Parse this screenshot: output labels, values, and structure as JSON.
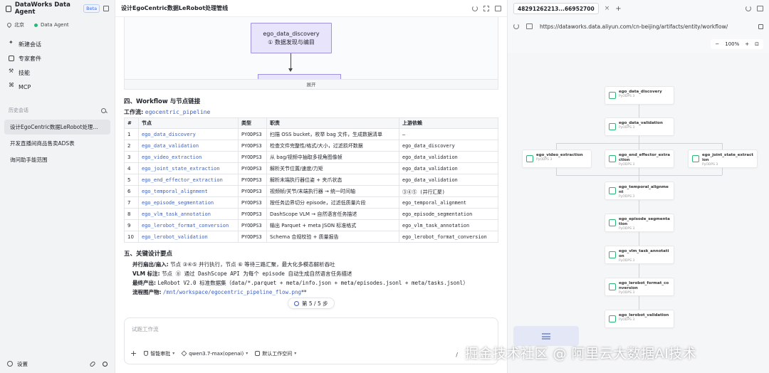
{
  "app": {
    "title": "DataWorks Data Agent",
    "badge": "Beta"
  },
  "sidebar": {
    "region": "北京",
    "agent": "Data Agent",
    "nav": [
      {
        "label": "新建会话",
        "icon": "sparkle-icon"
      },
      {
        "label": "专家套件",
        "icon": "box-icon"
      },
      {
        "label": "技能",
        "icon": "wrench-icon"
      },
      {
        "label": "MCP",
        "icon": "mcp-icon"
      }
    ],
    "history_title": "历史会话",
    "history": [
      "设计EgoCentric数据LeRobot处理...",
      "开发直播间商品售卖ADS表",
      "询问助手能范围"
    ],
    "settings": "设置"
  },
  "main": {
    "title": "设计EgoCentric数据LeRobot处理管线",
    "diagram": {
      "node_name": "ego_data_discovery",
      "node_desc": "① 数据发现与编目",
      "expand": "展开"
    },
    "section4": "四、Workflow 与节点链接",
    "workflow_label": "工作流:",
    "workflow_name": "egocentric_pipeline",
    "table": {
      "headers": [
        "#",
        "节点",
        "类型",
        "职责",
        "上游依赖"
      ],
      "rows": [
        [
          "1",
          "ego_data_discovery",
          "PYODPS3",
          "扫描 OSS bucket，枚举 bag 文件，生成数据清单",
          "—"
        ],
        [
          "2",
          "ego_data_validation",
          "PYODPS3",
          "检查文件完整性/格式/大小，过滤损坏数据",
          "ego_data_discovery"
        ],
        [
          "3",
          "ego_video_extraction",
          "PYODPS3",
          "从 bag/视频中抽取多视角图像帧",
          "ego_data_validation"
        ],
        [
          "4",
          "ego_joint_state_extraction",
          "PYODPS3",
          "解析关节位置/速度/力矩",
          "ego_data_validation"
        ],
        [
          "5",
          "ego_end_effector_extraction",
          "PYODPS3",
          "解析末端执行器位姿 + 夹爪状态",
          "ego_data_validation"
        ],
        [
          "6",
          "ego_temporal_alignment",
          "PYODPS3",
          "视频帧/关节/末端执行器 → 统一时间轴",
          "③④⑤ (并行汇聚)"
        ],
        [
          "7",
          "ego_episode_segmentation",
          "PYODPS3",
          "按任务边界切分 episode，过滤低质量片段",
          "ego_temporal_alignment"
        ],
        [
          "8",
          "ego_vlm_task_annotation",
          "PYODPS3",
          "DashScope VLM → 自然语言任务描述",
          "ego_episode_segmentation"
        ],
        [
          "9",
          "ego_lerobot_format_conversion",
          "PYODPS3",
          "输出 Parquet + meta JSON 标准格式",
          "ego_vlm_task_annotation"
        ],
        [
          "10",
          "ego_lerobot_validation",
          "PYODPS3",
          "Schema 合规校验 + 质量报告",
          "ego_lerobot_format_conversion"
        ]
      ]
    },
    "section5": "五、关键设计要点",
    "points": [
      {
        "label": "并行扇出/扇入:",
        "text": "节点 ③④⑤ 并行执行，节点 ⑥ 等待三路汇聚，最大化多模态解析吞吐"
      },
      {
        "label": "VLM 标注:",
        "text": "节点 ⑧ 通过 DashScope API 为每个 episode 自动生成自然语言任务描述"
      },
      {
        "label": "最终产出:",
        "text": "LeRobot V2.0 标准数据集（data/*.parquet + meta/info.json + meta/episodes.jsonl + meta/tasks.jsonl）"
      },
      {
        "label": "流程图产物:",
        "text": "/mnt/workspace/egocentric_pipeline_flow.png",
        "suffix": "**"
      }
    ],
    "step": "第 5 / 5 步",
    "input_placeholder": "试跑工作流",
    "tools": {
      "mode": "智能审批",
      "model": "qwen3.7-max(openai)",
      "workspace": "默认工作空间",
      "slash": "/"
    }
  },
  "right": {
    "tab": "48291262213...66952700",
    "url": "https://dataworks.data.aliyun.com/cn-beijing/artifacts/entity/workflow/",
    "zoom": "100%",
    "node_type": "PyODPS 3",
    "nodes": [
      "ego_data_discovery",
      "ego_data_validation",
      "ego_video_extraction",
      "ego_end_effector_extraction",
      "ego_joint_state_extraction",
      "ego_temporal_alignment",
      "ego_episode_segmentation",
      "ego_vlm_task_annotation",
      "ego_lerobot_format_conversion",
      "ego_lerobot_validation"
    ]
  },
  "watermark": "掘金技术社区 @ 阿里云大数据AI技术"
}
